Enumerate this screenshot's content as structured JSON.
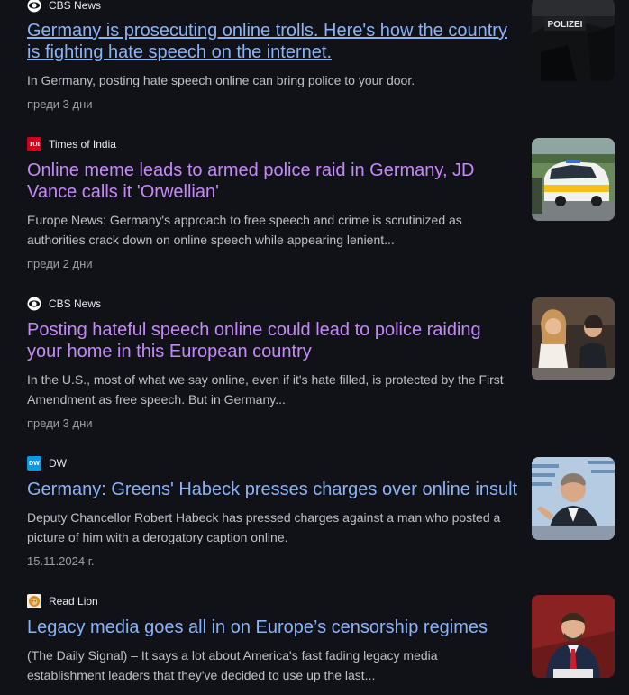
{
  "articles": [
    {
      "source": "CBS News",
      "source_icon": "cbs-eye-icon",
      "title": "Germany is prosecuting online trolls. Here's how the country is fighting hate speech on the internet.",
      "snippet": "In Germany, posting hate speech online can bring police to your door.",
      "date": "преди 3 дни",
      "link_color": "#8ab4f8",
      "thumbnail_text": "POLIZEI"
    },
    {
      "source": "Times of India",
      "source_icon": "toi-icon",
      "source_icon_text": "TOI",
      "title": "Online meme leads to armed police raid in Germany, JD Vance calls it 'Orwellian'",
      "snippet": "Europe News: Germany's approach to free speech and crime is scrutinized as authorities crack down on online speech while appearing lenient...",
      "date": "преди 2 дни",
      "link_color": "#c58af9"
    },
    {
      "source": "CBS News",
      "source_icon": "cbs-eye-icon",
      "title": "Posting hateful speech online could lead to police raiding your home in this European country",
      "snippet": "In the U.S., most of what we say online, even if it's hate filled, is protected by the First Amendment as free speech. But in Germany...",
      "date": "преди 3 дни",
      "link_color": "#c58af9"
    },
    {
      "source": "DW",
      "source_icon": "dw-icon",
      "source_icon_text": "DW",
      "title": "Germany: Greens' Habeck presses charges over online insult",
      "snippet": "Deputy Chancellor Robert Habeck has pressed charges against a man who posted a picture of him with a derogatory caption online.",
      "date": "15.11.2024 г.",
      "link_color": "#8ab4f8"
    },
    {
      "source": "Read Lion",
      "source_icon": "lion-icon",
      "title": "Legacy media goes all in on Europe’s censorship regimes",
      "snippet": "(The Daily Signal) – It says a lot about America's fast fading legacy media establishment leaders that they've decided to use up the last...",
      "link_color": "#8ab4f8"
    }
  ]
}
